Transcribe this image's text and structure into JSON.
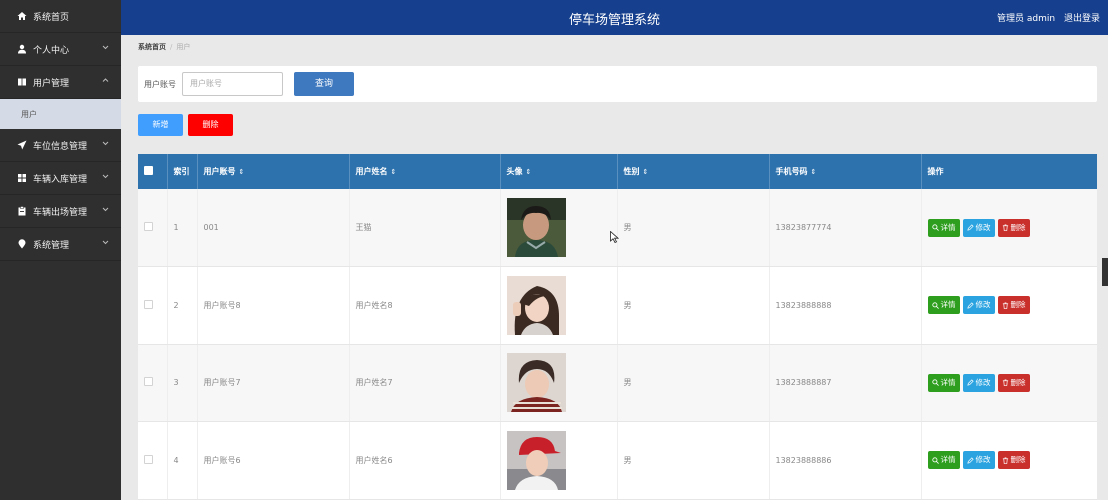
{
  "header": {
    "title": "停车场管理系统",
    "user": "管理员 admin",
    "logout": "退出登录"
  },
  "sidebar": {
    "items": [
      {
        "label": "系统首页",
        "icon": "home-icon"
      },
      {
        "label": "个人中心",
        "icon": "user-icon"
      },
      {
        "label": "用户管理",
        "icon": "book-icon"
      },
      {
        "label": "车位信息管理",
        "icon": "send-icon"
      },
      {
        "label": "车辆入库管理",
        "icon": "grid-icon"
      },
      {
        "label": "车辆出场管理",
        "icon": "clipboard-icon"
      },
      {
        "label": "系统管理",
        "icon": "pin-icon"
      }
    ],
    "sub_item": "用户"
  },
  "breadcrumb": {
    "home": "系统首页",
    "sep": "/",
    "current": "用户"
  },
  "search": {
    "label": "用户账号",
    "placeholder": "用户账号",
    "button": "查询"
  },
  "actions": {
    "add": "新增",
    "delete": "删除"
  },
  "table": {
    "columns": [
      "",
      "索引",
      "用户账号",
      "用户姓名",
      "头像",
      "性别",
      "手机号码",
      "操作"
    ],
    "sort_glyph": "⇕",
    "op_labels": {
      "detail": "详情",
      "edit": "修改",
      "delete": "删除"
    },
    "rows": [
      {
        "index": "1",
        "account": "001",
        "name": "王猫",
        "gender": "男",
        "phone": "13823877774"
      },
      {
        "index": "2",
        "account": "用户账号8",
        "name": "用户姓名8",
        "gender": "男",
        "phone": "13823888888"
      },
      {
        "index": "3",
        "account": "用户账号7",
        "name": "用户姓名7",
        "gender": "男",
        "phone": "13823888887"
      },
      {
        "index": "4",
        "account": "用户账号6",
        "name": "用户姓名6",
        "gender": "男",
        "phone": "13823888886"
      }
    ]
  },
  "colors": {
    "header": "#163f8d",
    "sidebar": "#2f2f2f",
    "table_head": "#2e72ad",
    "detail": "#2d9e1d",
    "edit": "#2aa3e0",
    "delete": "#c9302c",
    "add": "#409eff",
    "delete_batch": "#ff0000"
  }
}
